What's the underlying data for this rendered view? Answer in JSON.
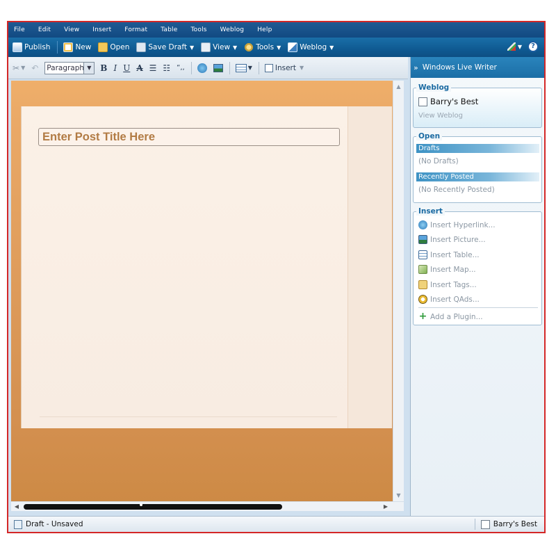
{
  "menu": [
    "File",
    "Edit",
    "View",
    "Insert",
    "Format",
    "Table",
    "Tools",
    "Weblog",
    "Help"
  ],
  "toolbar": {
    "publish": "Publish",
    "new": "New",
    "open": "Open",
    "save_draft": "Save Draft",
    "view": "View",
    "tools": "Tools",
    "weblog": "Weblog",
    "help_glyph": "?"
  },
  "format": {
    "paragraph_style": "Paragraph",
    "bold": "B",
    "italic": "I",
    "underline": "U",
    "strikethrough": "A",
    "blockquote": "“,,",
    "insert_label": "Insert"
  },
  "editor": {
    "title_placeholder": "Enter Post Title Here"
  },
  "sidebar": {
    "header": "Windows Live Writer",
    "weblog_group": "Weblog",
    "blog_name": "Barry's Best",
    "view_weblog": "View Weblog",
    "open_group": "Open",
    "drafts_label": "Drafts",
    "no_drafts": "(No Drafts)",
    "recently_posted_label": "Recently Posted",
    "no_recent": "(No Recently Posted)",
    "insert_group": "Insert",
    "insert_items": [
      "Insert Hyperlink...",
      "Insert Picture...",
      "Insert Table...",
      "Insert Map...",
      "Insert Tags...",
      "Insert QAds..."
    ],
    "add_plugin": "Add a Plugin..."
  },
  "status": {
    "left": "Draft - Unsaved",
    "right": "Barry's Best"
  },
  "colors": {
    "frame_border": "#d42727",
    "menubar": "#124a82",
    "editor_top": "#efaf6a",
    "editor_bottom": "#cd8a45",
    "title_text": "#b27b44",
    "group_title": "#1a6aa2"
  }
}
